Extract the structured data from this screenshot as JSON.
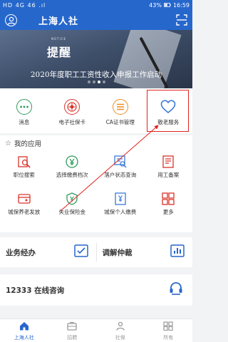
{
  "status_bar": {
    "carrier": "HD 4G 46 .ıl",
    "battery": "43%",
    "time": "16:59"
  },
  "header": {
    "title": "上海人社"
  },
  "banner": {
    "notice_small": "NOTICE",
    "notice_title": "提醒",
    "text": "2020年度职工工资性收入申报工作启动",
    "active_dot": 2
  },
  "quick_actions": [
    {
      "label": "消息",
      "icon": "message-icon",
      "color": "#2e9b5b"
    },
    {
      "label": "电子社保卡",
      "icon": "social-card-icon",
      "color": "#d9342b"
    },
    {
      "label": "CA证书管理",
      "icon": "certificate-icon",
      "color": "#f08c1e"
    },
    {
      "label": "敬老服务",
      "icon": "heart-icon",
      "color": "#3d7bd6"
    }
  ],
  "my_apps": {
    "title": "我的应用",
    "items": [
      {
        "label": "职位搜索",
        "icon": "job-search-icon"
      },
      {
        "label": "选择缴费档次",
        "icon": "payment-level-icon"
      },
      {
        "label": "落户状态查询",
        "icon": "residence-query-icon"
      },
      {
        "label": "用工备案",
        "icon": "employment-record-icon"
      },
      {
        "label": "城保养老发放",
        "icon": "pension-icon"
      },
      {
        "label": "失业保险金",
        "icon": "unemployment-insurance-icon"
      },
      {
        "label": "城保个人缴费",
        "icon": "personal-payment-icon"
      },
      {
        "label": "更多",
        "icon": "more-icon"
      }
    ]
  },
  "services": [
    {
      "label": "业务经办",
      "icon": "checklist-icon"
    },
    {
      "label": "调解仲裁",
      "icon": "bar-chart-icon"
    }
  ],
  "consult": {
    "label": "12333 在线咨询",
    "icon": "headset-icon"
  },
  "bottom_nav": [
    {
      "label": "上海人社",
      "icon": "home-icon",
      "active": true
    },
    {
      "label": "招聘",
      "icon": "recruit-icon",
      "active": false
    },
    {
      "label": "社保",
      "icon": "social-security-icon",
      "active": false
    },
    {
      "label": "所有",
      "icon": "all-icon",
      "active": false
    }
  ],
  "colors": {
    "primary": "#2667cc",
    "highlight": "#e0221f"
  }
}
